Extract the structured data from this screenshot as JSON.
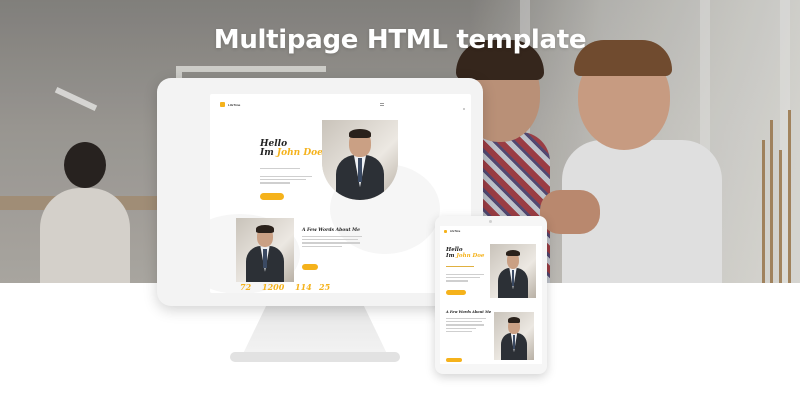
{
  "banner": {
    "title": "Multipage HTML template"
  },
  "desktop_preview": {
    "logo_text": "LifeTime",
    "hello_line1": "Hello",
    "hello_line2_prefix": "Im ",
    "hello_name": "John Doe",
    "about_heading": "A Few Words About Me",
    "stats": [
      "72",
      "1200",
      "114",
      "25"
    ]
  },
  "tablet_preview": {
    "logo_text": "LifeTime",
    "hello_line1": "Hello",
    "hello_line2_prefix": "Im ",
    "hello_name": "John Doe",
    "about_heading": "A Few Words About Me"
  },
  "colors": {
    "accent": "#f5b21b",
    "device": "#f3f3f3",
    "banner_text": "#ffffff"
  }
}
